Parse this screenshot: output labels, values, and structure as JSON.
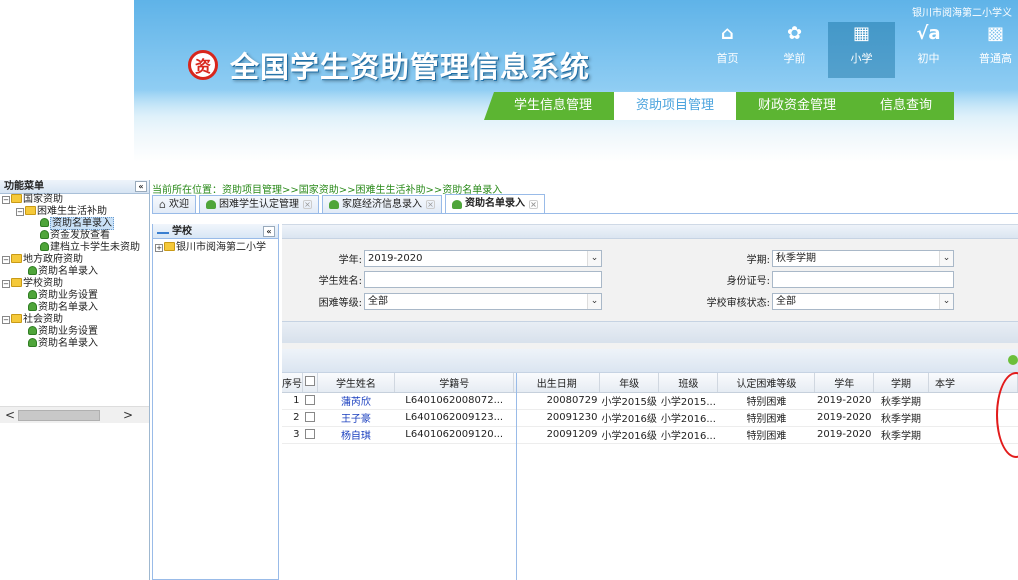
{
  "header": {
    "school_name": "银川市阅海第二小学义",
    "logo_glyph": "资",
    "system_title": "全国学生资助管理信息系统",
    "nav_icons": [
      {
        "glyph": "⌂",
        "label": "首页",
        "icon": "home-icon"
      },
      {
        "glyph": "✿",
        "label": "学前",
        "icon": "preschool-icon"
      },
      {
        "glyph": "▦",
        "label": "小学",
        "icon": "primary-school-icon"
      },
      {
        "glyph": "√a",
        "label": "初中",
        "icon": "junior-high-icon"
      },
      {
        "glyph": "▩",
        "label": "普通高",
        "icon": "senior-high-icon"
      }
    ],
    "menu": [
      "学生信息管理",
      "资助项目管理",
      "财政资金管理",
      "信息查询"
    ]
  },
  "sidebar": {
    "title": "功能菜单",
    "collapse_glyph": "«",
    "items": [
      {
        "label": "国家资助",
        "level": 0,
        "type": "folder",
        "toggle": "−"
      },
      {
        "label": "困难生生活补助",
        "level": 1,
        "type": "folder",
        "toggle": "−"
      },
      {
        "label": "资助名单录入",
        "level": 2,
        "type": "leaf",
        "selected": true
      },
      {
        "label": "资金发放查看",
        "level": 2,
        "type": "leaf"
      },
      {
        "label": "建档立卡学生未资助",
        "level": 2,
        "type": "leaf"
      },
      {
        "label": "地方政府资助",
        "level": 0,
        "type": "folder",
        "toggle": "−"
      },
      {
        "label": "资助名单录入",
        "level": 1,
        "type": "leaf"
      },
      {
        "label": "学校资助",
        "level": 0,
        "type": "folder",
        "toggle": "−"
      },
      {
        "label": "资助业务设置",
        "level": 1,
        "type": "leaf"
      },
      {
        "label": "资助名单录入",
        "level": 1,
        "type": "leaf"
      },
      {
        "label": "社会资助",
        "level": 0,
        "type": "folder",
        "toggle": "−"
      },
      {
        "label": "资助业务设置",
        "level": 1,
        "type": "leaf"
      },
      {
        "label": "资助名单录入",
        "level": 1,
        "type": "leaf"
      }
    ],
    "scroll_left": "<",
    "scroll_right": ">"
  },
  "breadcrumb": "当前所在位置：资助项目管理>>国家资助>>困难生生活补助>>资助名单录入",
  "tabs": [
    {
      "label": "欢迎",
      "closable": false,
      "home": true
    },
    {
      "label": "困难学生认定管理",
      "closable": true
    },
    {
      "label": "家庭经济信息录入",
      "closable": true
    },
    {
      "label": "资助名单录入",
      "closable": true,
      "active": true
    }
  ],
  "school_panel": {
    "title": "学校",
    "collapse_glyph": "«",
    "toggle": "+",
    "node": "银川市阅海第二小学"
  },
  "form": {
    "year_label": "学年:",
    "year_value": "2019-2020",
    "term_label": "学期:",
    "term_value": "秋季学期",
    "name_label": "学生姓名:",
    "name_value": "",
    "id_label": "身份证号:",
    "id_value": "",
    "level_label": "困难等级:",
    "level_value": "全部",
    "review_label": "学校审核状态:",
    "review_value": "全部",
    "dropdown_glyph": "⌄"
  },
  "grid": {
    "columns": [
      "序号",
      "",
      "学生姓名",
      "学籍号",
      "出生日期",
      "年级",
      "班级",
      "认定困难等级",
      "学年",
      "学期",
      "本学"
    ],
    "rows": [
      [
        "1",
        "",
        "蒲芮欣",
        "L6401062008072...",
        "20080729",
        "小学2015级",
        "小学2015...",
        "特别困难",
        "2019-2020",
        "秋季学期",
        ""
      ],
      [
        "2",
        "",
        "王子豪",
        "L6401062009123...",
        "20091230",
        "小学2016级",
        "小学2016...",
        "特别困难",
        "2019-2020",
        "秋季学期",
        ""
      ],
      [
        "3",
        "",
        "杨自琪",
        "L6401062009120...",
        "20091209",
        "小学2016级",
        "小学2016...",
        "特别困难",
        "2019-2020",
        "秋季学期",
        ""
      ]
    ]
  },
  "colors": {
    "menu_green": "#5cb532",
    "banner_blue": "#5fb3e8",
    "link_blue": "#1a3fbf",
    "annotation_red": "#e21b1b"
  }
}
